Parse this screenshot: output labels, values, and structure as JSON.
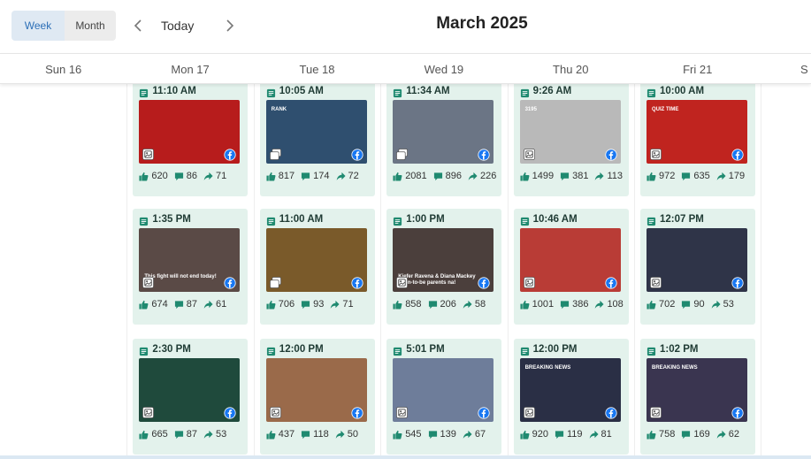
{
  "toolbar": {
    "week_label": "Week",
    "month_label": "Month",
    "today_label": "Today",
    "prev_icon": "chevron-left-icon",
    "next_icon": "chevron-right-icon",
    "title": "March 2025"
  },
  "colors": {
    "card_bg": "#e3f2ec",
    "accent_teal": "#1f8a70",
    "facebook_blue": "#1877f2",
    "week_active_bg": "#dfe9f3"
  },
  "days": [
    {
      "label": "Sun 16"
    },
    {
      "label": "Mon 17"
    },
    {
      "label": "Tue 18"
    },
    {
      "label": "Wed 19"
    },
    {
      "label": "Thu 20"
    },
    {
      "label": "Fri 21"
    },
    {
      "label": "S"
    }
  ],
  "posts": [
    {
      "day": 1,
      "row": 0,
      "time": "11:10 AM",
      "likes": "620",
      "comments": "86",
      "shares": "71",
      "thumb_bg": "#b71c1c",
      "type": "image"
    },
    {
      "day": 2,
      "row": 0,
      "time": "10:05 AM",
      "likes": "817",
      "comments": "174",
      "shares": "72",
      "thumb_bg": "#2f4f6f",
      "type": "album",
      "thumb_text": "RANK"
    },
    {
      "day": 3,
      "row": 0,
      "time": "11:34 AM",
      "likes": "2081",
      "comments": "896",
      "shares": "226",
      "thumb_bg": "#6b7585",
      "type": "album"
    },
    {
      "day": 4,
      "row": 0,
      "time": "9:26 AM",
      "likes": "1499",
      "comments": "381",
      "shares": "113",
      "thumb_bg": "#b9b9b9",
      "type": "image",
      "thumb_text": "3195"
    },
    {
      "day": 5,
      "row": 0,
      "time": "10:00 AM",
      "likes": "972",
      "comments": "635",
      "shares": "179",
      "thumb_bg": "#c0241f",
      "type": "image",
      "thumb_text": "QUIZ TIME"
    },
    {
      "day": 1,
      "row": 1,
      "time": "1:35 PM",
      "likes": "674",
      "comments": "87",
      "shares": "61",
      "thumb_bg": "#5a4a46",
      "type": "image",
      "thumb_text": "This fight will not end today!"
    },
    {
      "day": 2,
      "row": 1,
      "time": "11:00 AM",
      "likes": "706",
      "comments": "93",
      "shares": "71",
      "thumb_bg": "#7a5a2a",
      "type": "album"
    },
    {
      "day": 3,
      "row": 1,
      "time": "1:00 PM",
      "likes": "858",
      "comments": "206",
      "shares": "58",
      "thumb_bg": "#4b3f3c",
      "type": "image",
      "thumb_text": "Kiefer Ravena & Diana Mackey soon-to-be parents na!"
    },
    {
      "day": 4,
      "row": 1,
      "time": "10:46 AM",
      "likes": "1001",
      "comments": "386",
      "shares": "108",
      "thumb_bg": "#b93c36",
      "type": "image"
    },
    {
      "day": 5,
      "row": 1,
      "time": "12:07 PM",
      "likes": "702",
      "comments": "90",
      "shares": "53",
      "thumb_bg": "#2f3448",
      "type": "image"
    },
    {
      "day": 1,
      "row": 2,
      "time": "2:30 PM",
      "likes": "665",
      "comments": "87",
      "shares": "53",
      "thumb_bg": "#1f4a3c",
      "type": "image"
    },
    {
      "day": 2,
      "row": 2,
      "time": "12:00 PM",
      "likes": "437",
      "comments": "118",
      "shares": "50",
      "thumb_bg": "#9a6a4a",
      "type": "image"
    },
    {
      "day": 3,
      "row": 2,
      "time": "5:01 PM",
      "likes": "545",
      "comments": "139",
      "shares": "67",
      "thumb_bg": "#6e7d9a",
      "type": "image"
    },
    {
      "day": 4,
      "row": 2,
      "time": "12:00 PM",
      "likes": "920",
      "comments": "119",
      "shares": "81",
      "thumb_bg": "#2a2f45",
      "type": "image",
      "thumb_text": "BREAKING NEWS"
    },
    {
      "day": 5,
      "row": 2,
      "time": "1:02 PM",
      "likes": "758",
      "comments": "169",
      "shares": "62",
      "thumb_bg": "#3a3550",
      "type": "image",
      "thumb_text": "BREAKING NEWS"
    }
  ]
}
